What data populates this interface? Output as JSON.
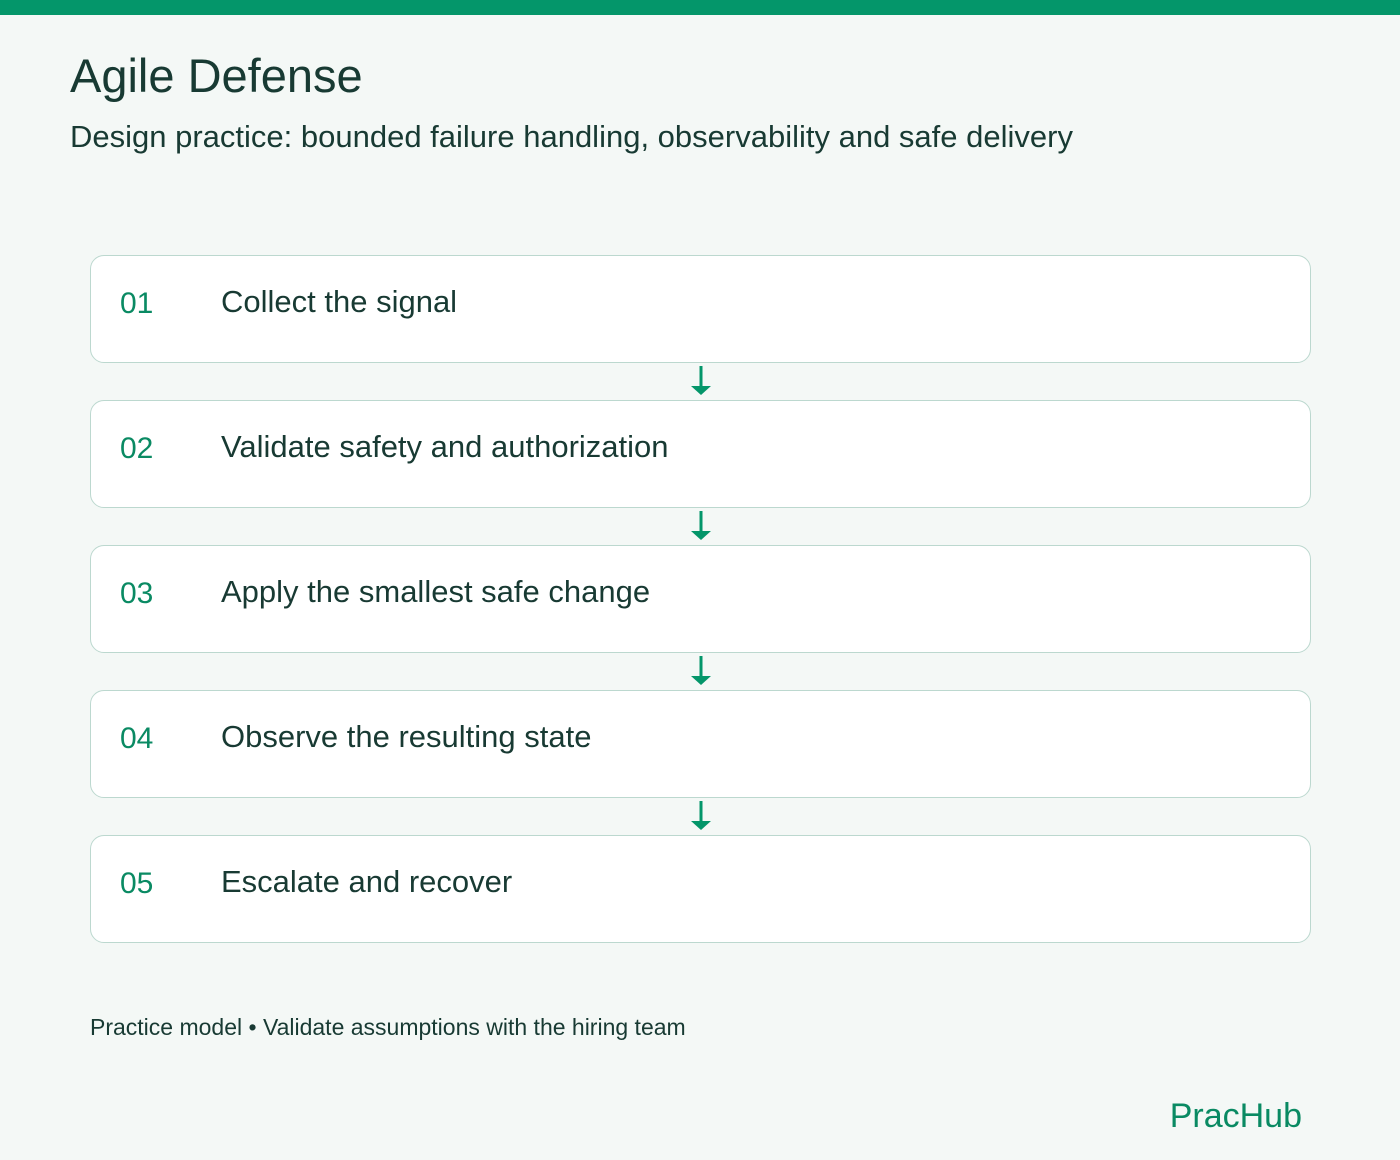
{
  "colors": {
    "accent": "#04966a",
    "number_text": "#0a8a63",
    "primary_text": "#183a33",
    "card_border": "#bcd8cf",
    "background": "#f4f8f6"
  },
  "header": {
    "title": "Agile Defense",
    "subtitle": "Design practice: bounded failure handling, observability and safe delivery"
  },
  "steps": [
    {
      "number": "01",
      "label": "Collect the signal"
    },
    {
      "number": "02",
      "label": "Validate safety and authorization"
    },
    {
      "number": "03",
      "label": "Apply the smallest safe change"
    },
    {
      "number": "04",
      "label": "Observe the resulting state"
    },
    {
      "number": "05",
      "label": "Escalate and recover"
    }
  ],
  "footer": {
    "note": "Practice model • Validate assumptions with the hiring team",
    "brand": "PracHub"
  }
}
